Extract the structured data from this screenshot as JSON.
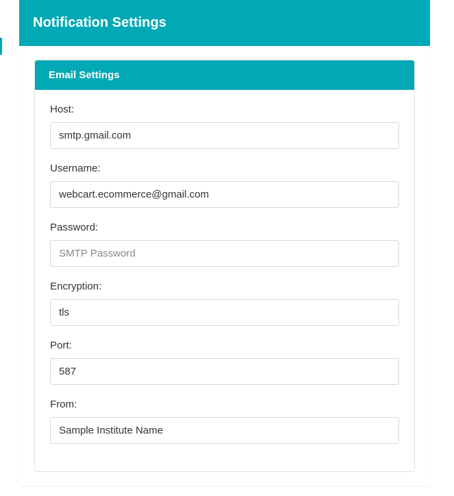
{
  "page": {
    "title": "Notification Settings"
  },
  "emailSettings": {
    "title": "Email Settings",
    "fields": {
      "host": {
        "label": "Host:",
        "value": "smtp.gmail.com"
      },
      "username": {
        "label": "Username:",
        "value": "webcart.ecommerce@gmail.com"
      },
      "password": {
        "label": "Password:",
        "value": "",
        "placeholder": "SMTP Password"
      },
      "encryption": {
        "label": "Encryption:",
        "value": "tls"
      },
      "port": {
        "label": "Port:",
        "value": "587"
      },
      "from": {
        "label": "From:",
        "value": "Sample Institute Name"
      }
    }
  }
}
